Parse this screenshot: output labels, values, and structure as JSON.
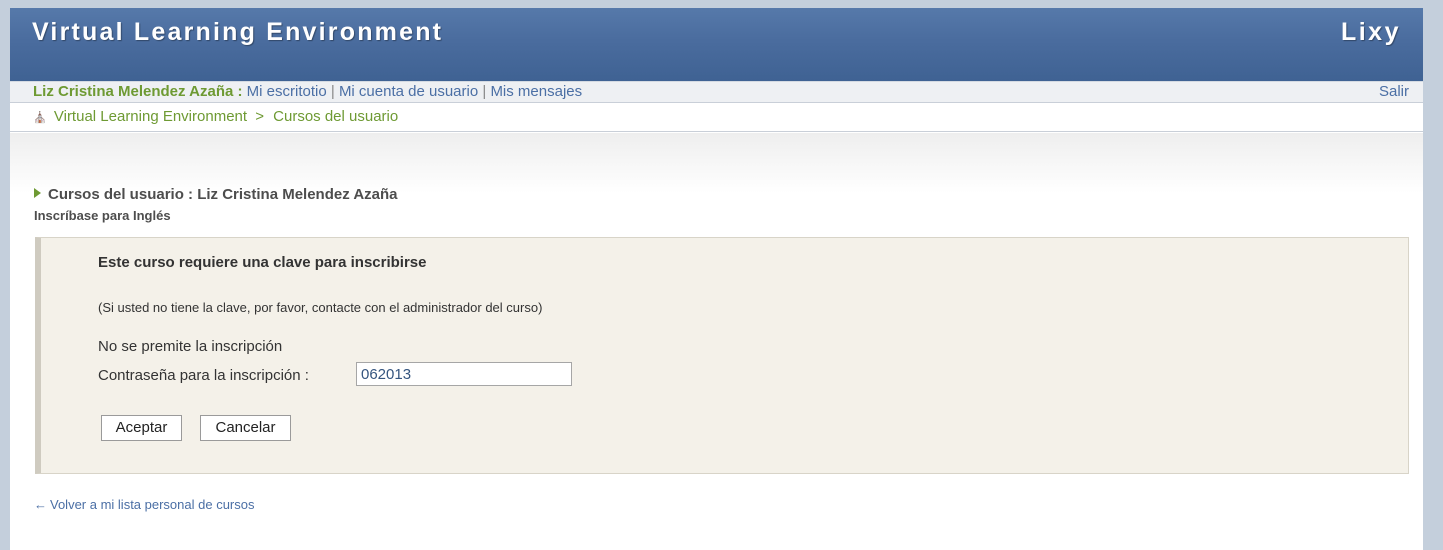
{
  "header": {
    "title": "Virtual Learning Environment",
    "brand": "Lixy"
  },
  "userbar": {
    "user_name": "Liz Cristina Melendez Azaña :",
    "links": [
      "Mi escritotio",
      "Mi cuenta de usuario",
      "Mis mensajes"
    ],
    "separator": "|",
    "logout": "Salir"
  },
  "breadcrumb": {
    "home_icon": "home-icon",
    "root": "Virtual Learning Environment",
    "separator": ">",
    "current": "Cursos del usuario"
  },
  "section": {
    "title": "Cursos del usuario : Liz Cristina Melendez Azaña",
    "subtitle": "Inscríbase para Inglés"
  },
  "enroll": {
    "heading": "Este curso requiere una clave para inscribirse",
    "note": "(Si usted no tiene la clave, por favor, contacte con el administrador del curso)",
    "status": "No se premite la inscripción",
    "password_label": "Contraseña para la inscripción :",
    "password_value": "062013",
    "accept_label": "Aceptar",
    "cancel_label": "Cancelar"
  },
  "footer": {
    "back_arrow": "←",
    "back_link": "Volver a mi lista personal de cursos"
  },
  "colors": {
    "header_bg": "#4a6c9e",
    "accent_green": "#6e9a33",
    "link_blue": "#4b6fa5",
    "box_bg": "#f4f1e9"
  }
}
